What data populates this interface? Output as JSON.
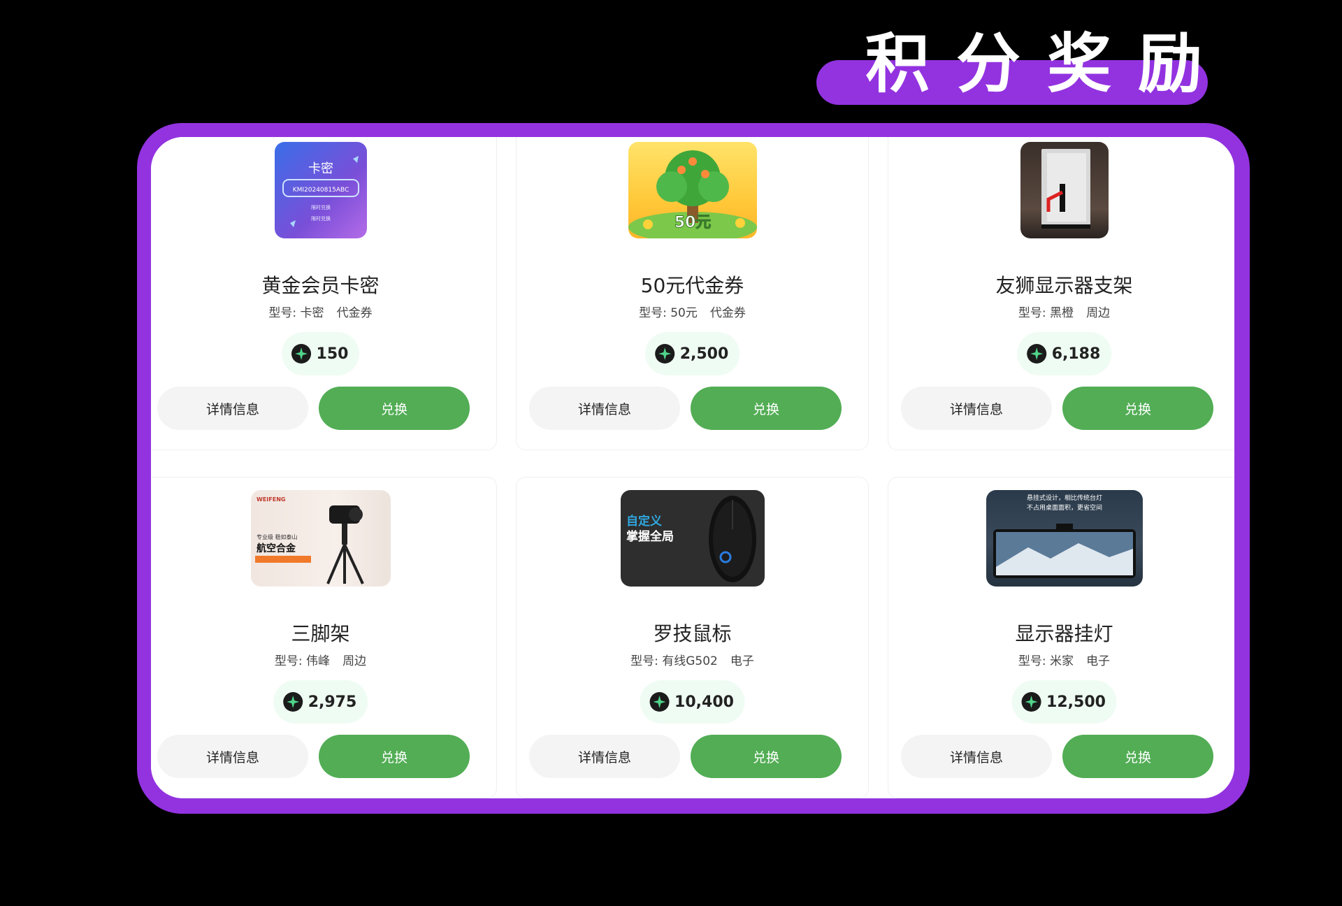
{
  "banner": {
    "title": "积分奖励"
  },
  "colors": {
    "brand_purple": "#9333e0",
    "redeem_green": "#52ad55",
    "price_bg": "#effcf3"
  },
  "icons": {
    "currency": "star-coin-icon"
  },
  "products": [
    {
      "name": "黄金会员卡密",
      "model": "型号: 卡密",
      "category": "代金券",
      "points": "150",
      "thumb": {
        "heading": "卡密",
        "code": "KMI20240815ABC",
        "line1": "限时兑换",
        "line2": "限时兑换"
      },
      "detail_label": "详情信息",
      "redeem_label": "兑换"
    },
    {
      "name": "50元代金券",
      "model": "型号: 50元",
      "category": "代金券",
      "points": "2,500",
      "thumb": {
        "text": "50元"
      },
      "detail_label": "详情信息",
      "redeem_label": "兑换"
    },
    {
      "name": "友狮显示器支架",
      "model": "型号: 黑橙",
      "category": "周边",
      "points": "6,188",
      "thumb": {},
      "detail_label": "详情信息",
      "redeem_label": "兑换"
    },
    {
      "name": "三脚架",
      "model": "型号: 伟峰",
      "category": "周边",
      "points": "2,975",
      "thumb": {
        "brand": "WEIFENG",
        "line1": "专业级 稳如泰山",
        "line2": "航空合金"
      },
      "detail_label": "详情信息",
      "redeem_label": "兑换"
    },
    {
      "name": "罗技鼠标",
      "model": "型号: 有线G502",
      "category": "电子",
      "points": "10,400",
      "thumb": {
        "line1": "自定义",
        "line2": "掌握全局"
      },
      "detail_label": "详情信息",
      "redeem_label": "兑换"
    },
    {
      "name": "显示器挂灯",
      "model": "型号: 米家",
      "category": "电子",
      "points": "12,500",
      "thumb": {
        "line1": "悬挂式设计，相比传统台灯",
        "line2": "不占用桌面面积，更省空间"
      },
      "detail_label": "详情信息",
      "redeem_label": "兑换"
    }
  ]
}
